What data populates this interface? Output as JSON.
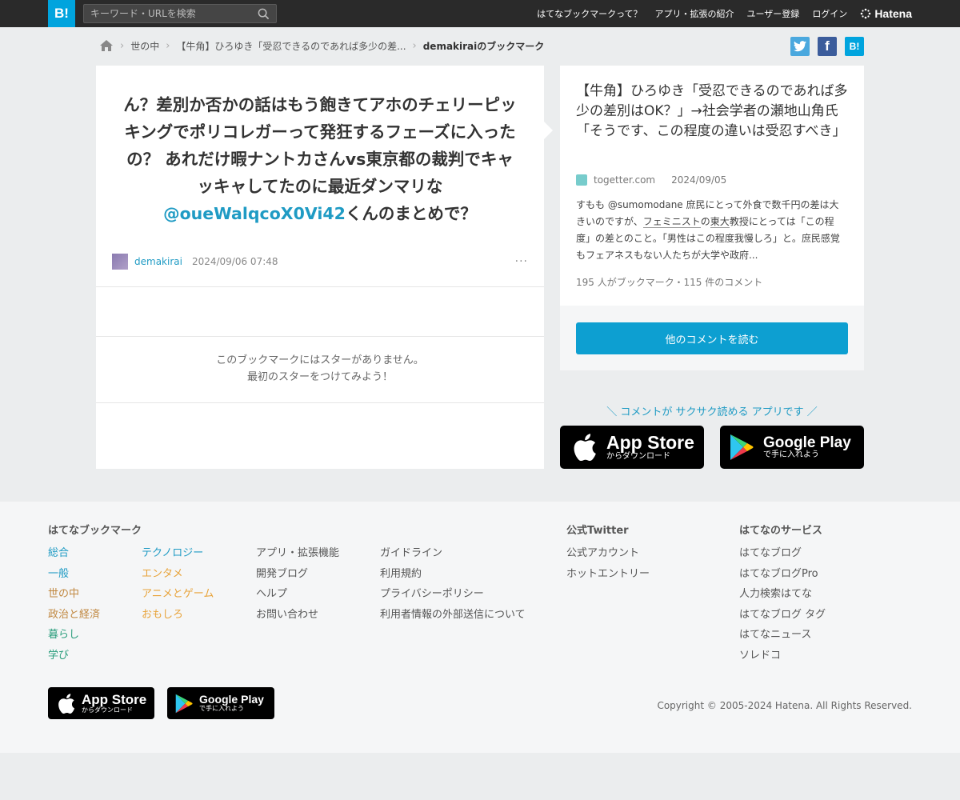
{
  "topbar": {
    "logo": "B!",
    "search_placeholder": "キーワード・URLを検索",
    "nav": [
      "はてなブックマークって？",
      "アプリ・拡張の紹介",
      "ユーザー登録",
      "ログイン"
    ],
    "brand": "Hatena"
  },
  "breadcrumb": {
    "items": [
      "世の中",
      "【牛角】ひろゆき「受忍できるのであれば多少の差...",
      "demakiraiのブックマーク"
    ]
  },
  "share": {
    "twitter": "t",
    "facebook": "f",
    "hatena": "B!"
  },
  "bookmark": {
    "comment_text": "ん？差別か否かの話はもう飽きてアホのチェリーピッキングでポリコレガーって発狂するフェーズに入ったの？ あれだけ暇ナントカさんvs東京都の裁判でキャッキャしてたのに最近ダンマリな",
    "mention": "@oueWalqcoX0Vi42",
    "comment_tail": "くんのまとめで？",
    "user": "demakirai",
    "datetime": "2024/09/06 07:48",
    "more": "···",
    "nostar_line1": "このブックマークにはスターがありません。",
    "nostar_line2": "最初のスターをつけてみよう！"
  },
  "entry": {
    "title": "【牛角】ひろゆき「受忍できるのであれば多少の差別はOK？」→社会学者の瀬地山角氏「そうです、この程度の違いは受忍すべき」",
    "domain": "togetter.com",
    "date": "2024/09/05",
    "excerpt_a": "すもも @sumomodane 庶民にとって外食で数千円の差は大きいのですが、",
    "excerpt_link1": "フェミニスト",
    "excerpt_b": "の",
    "excerpt_link2": "東大",
    "excerpt_c": "教授にとっては「この程度」の差とのこと。「男性はこの程度我慢しろ」と。庶民感覚もフェアネスもない人たちが大学や政府...",
    "counts": "195 人がブックマーク・115 件のコメント",
    "read_more": "他のコメントを読む"
  },
  "promo": {
    "text": "＼ コメントが サクサク読める アプリです ／",
    "appstore_name": "App Store",
    "appstore_sub": "からダウンロード",
    "googleplay_name": "Google Play",
    "googleplay_sub": "で手に入れよう"
  },
  "footer": {
    "heading_bookmark": "はてなブックマーク",
    "col1": [
      "総合",
      "一般",
      "世の中",
      "政治と経済",
      "暮らし",
      "学び"
    ],
    "col2": [
      "テクノロジー",
      "エンタメ",
      "アニメとゲーム",
      "おもしろ"
    ],
    "col3": [
      "アプリ・拡張機能",
      "開発ブログ",
      "ヘルプ",
      "お問い合わせ"
    ],
    "col4": [
      "ガイドライン",
      "利用規約",
      "プライバシーポリシー",
      "利用者情報の外部送信について"
    ],
    "heading_twitter": "公式Twitter",
    "twitter_links": [
      "公式アカウント",
      "ホットエントリー"
    ],
    "heading_services": "はてなのサービス",
    "service_links": [
      "はてなブログ",
      "はてなブログPro",
      "人力検索はてな",
      "はてなブログ タグ",
      "はてなニュース",
      "ソレドコ"
    ],
    "copyright": "Copyright © 2005-2024 Hatena. All Rights Reserved."
  },
  "colors": {
    "col1": [
      "#1f9bc4",
      "#1f9bc4",
      "#c0873f",
      "#c0873f",
      "#2a9d7c",
      "#2a9d7c"
    ],
    "col2": [
      "#1f9bc4",
      "#e8a33a",
      "#e8a33a",
      "#e8a33a"
    ]
  }
}
